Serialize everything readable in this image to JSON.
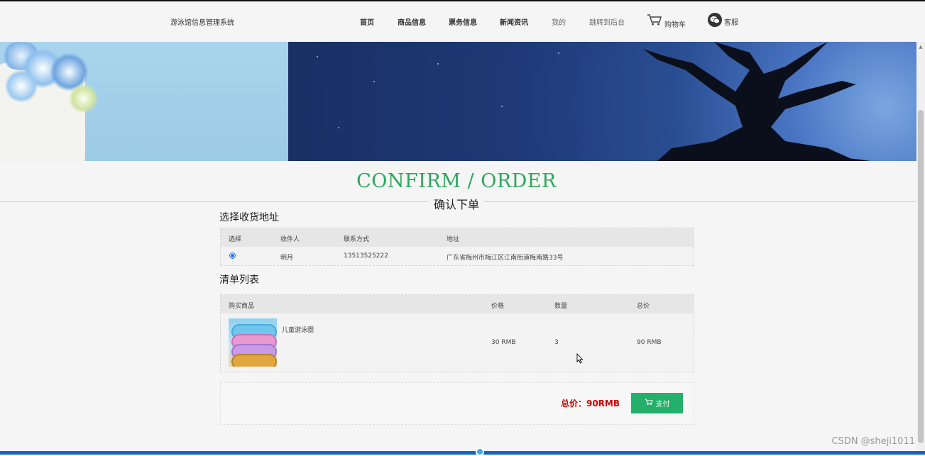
{
  "header": {
    "brand": "游泳馆信息管理系统",
    "nav": [
      {
        "label": "首页"
      },
      {
        "label": "商品信息"
      },
      {
        "label": "票务信息"
      },
      {
        "label": "新闻资讯"
      },
      {
        "label": "我的"
      },
      {
        "label": "跳转到后台"
      }
    ],
    "cart_label": "购物车",
    "service_label": "客服"
  },
  "heading": {
    "title_en": "CONFIRM / ORDER",
    "title_cn": "确认下单"
  },
  "address": {
    "section_title": "选择收货地址",
    "columns": [
      "选择",
      "收件人",
      "联系方式",
      "地址"
    ],
    "rows": [
      {
        "selected": true,
        "recipient": "明月",
        "phone": "13513525222",
        "address": "广东省梅州市梅江区江南街道梅南路33号"
      }
    ]
  },
  "orderlist": {
    "section_title": "清单列表",
    "columns": [
      "购买商品",
      "价格",
      "数量",
      "总价"
    ],
    "items": [
      {
        "name": "儿童游泳圈",
        "price": "30 RMB",
        "quantity": "3",
        "subtotal": "90 RMB"
      }
    ]
  },
  "payment": {
    "total": "总价：90RMB",
    "button_label": "支付"
  },
  "watermark": "CSDN @sheji1011",
  "colors": {
    "accent_green": "#2aa85c",
    "pay_button": "#24b06a",
    "total_red": "#cc0000"
  },
  "icons": [
    "cart-icon",
    "wechat-icon",
    "radio-checked-icon",
    "mouse-cursor-icon"
  ]
}
